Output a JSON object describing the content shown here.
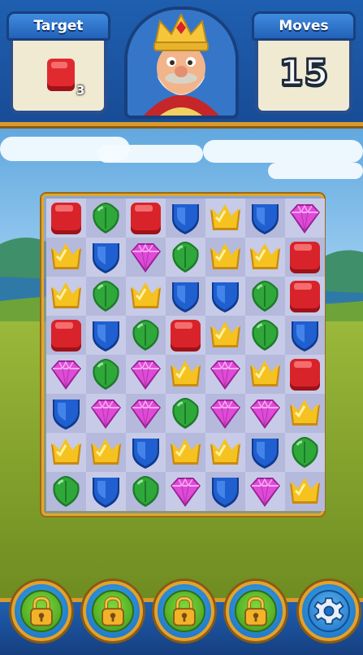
{
  "hud": {
    "target_label": "Target",
    "target_icon": "red-block",
    "target_count": "3",
    "moves_label": "Moves",
    "moves_value": "15",
    "portrait": "king-character"
  },
  "board": {
    "rows": 8,
    "cols": 7,
    "grid": [
      [
        "red",
        "leaf",
        "red",
        "shield",
        "crown",
        "shield",
        "gem"
      ],
      [
        "crown",
        "shield",
        "gem",
        "leaf",
        "crown",
        "crown",
        "red"
      ],
      [
        "crown",
        "leaf",
        "crown",
        "shield",
        "shield",
        "leaf",
        "red"
      ],
      [
        "red",
        "shield",
        "leaf",
        "red",
        "crown",
        "leaf",
        "shield"
      ],
      [
        "gem",
        "leaf",
        "gem",
        "crown",
        "gem",
        "crown",
        "red"
      ],
      [
        "shield",
        "gem",
        "gem",
        "leaf",
        "gem",
        "gem",
        "crown"
      ],
      [
        "crown",
        "crown",
        "shield",
        "crown",
        "crown",
        "shield",
        "leaf"
      ],
      [
        "leaf",
        "shield",
        "leaf",
        "gem",
        "shield",
        "gem",
        "crown"
      ]
    ]
  },
  "boosters": [
    "lock-icon",
    "lock-icon",
    "lock-icon",
    "lock-icon"
  ],
  "settings": "gear-icon",
  "colors": {
    "red": "#d8232a",
    "leaf": "#2fa83a",
    "shield": "#1f5fd0",
    "crown": "#f5c220",
    "gem": "#e04ad8"
  }
}
